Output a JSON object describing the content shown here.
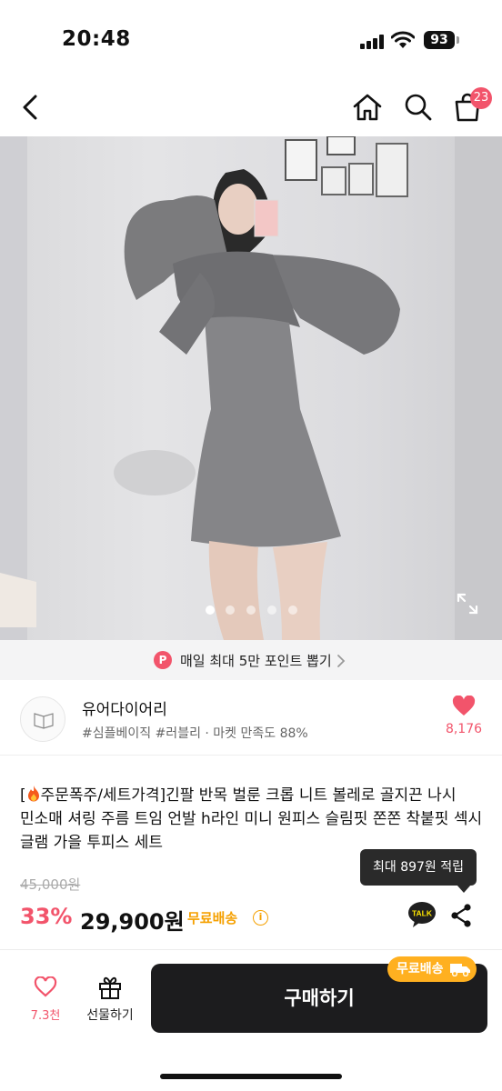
{
  "status_bar": {
    "time": "20:48",
    "battery": "93"
  },
  "nav": {
    "cart_count": "23"
  },
  "gallery": {
    "slide_count": 5,
    "active_index": 0
  },
  "point_banner": {
    "icon_letter": "P",
    "text": "매일 최대 5만 포인트 뽑기"
  },
  "shop": {
    "name": "유어다이어리",
    "tags": "#심플베이직 #러블리 · 마켓 만족도 88%",
    "like_count": "8,176"
  },
  "product": {
    "title_prefix": "[",
    "title_rest": "주문폭주/세트가격]긴팔 반목 벌룬 크롭 니트 볼레로 골지끈 나시 민소매 셔링 주름 트임 언발 h라인 미니 원피스 슬림핏 쫀쫀 착붙핏 섹시 글램 가을 투피스 세트"
  },
  "tooltip": {
    "text": "최대 897원 적립"
  },
  "price": {
    "original": "45,000원",
    "discount": "33%",
    "current": "29,900원",
    "free_shipping": "무료배송",
    "info_glyph": "i"
  },
  "share": {
    "talk_label": "TALK"
  },
  "bottom_bar": {
    "like_label": "7.3천",
    "gift_label": "선물하기",
    "buy_label": "구매하기",
    "buy_badge": "무료배송"
  },
  "colors": {
    "accent": "#f2546b",
    "shipping": "#f5a000",
    "dark": "#1c1c1e"
  }
}
